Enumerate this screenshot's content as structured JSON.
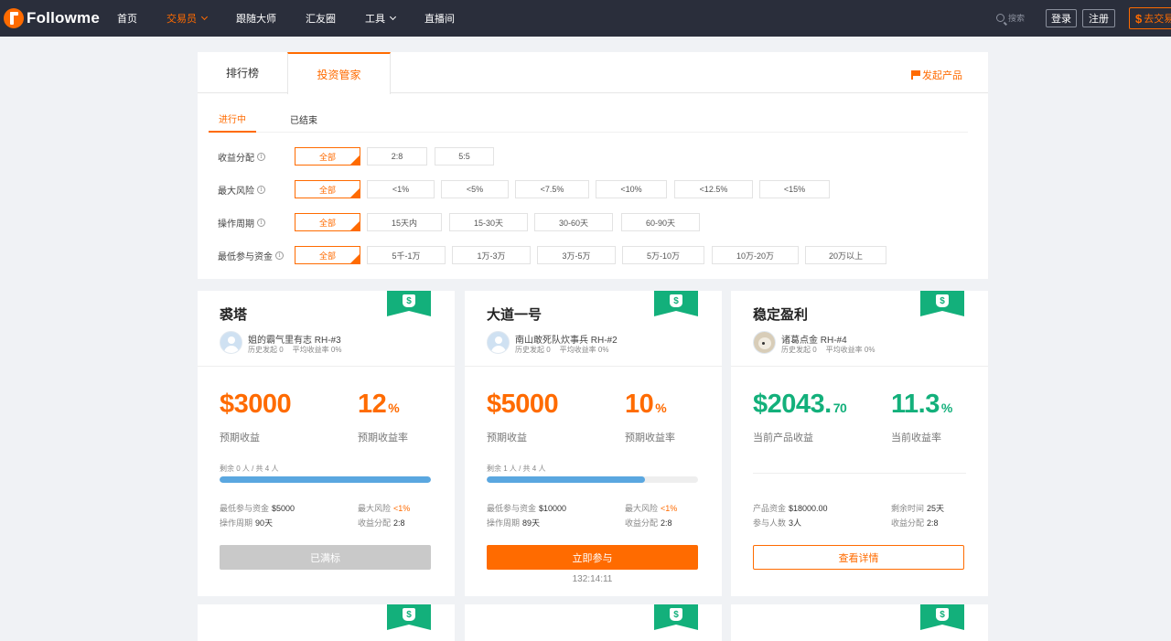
{
  "header": {
    "logo_text": "Followme",
    "nav": [
      {
        "label": "首页",
        "active": false,
        "dropdown": false
      },
      {
        "label": "交易员",
        "active": true,
        "dropdown": true
      },
      {
        "label": "跟随大师",
        "active": false,
        "dropdown": false
      },
      {
        "label": "汇友圈",
        "active": false,
        "dropdown": false
      },
      {
        "label": "工具",
        "active": false,
        "dropdown": true
      },
      {
        "label": "直播间",
        "active": false,
        "dropdown": false
      }
    ],
    "search_label": "搜索",
    "login": "登录",
    "register": "注册",
    "trade_label": "去交易",
    "accent": "#ff6b00",
    "bar_color": "#2a2e3b"
  },
  "panel": {
    "tabs": [
      "排行榜",
      "投资管家"
    ],
    "active_tab": 1,
    "launch": "发起产品",
    "subtabs": [
      "进行中",
      "已结束"
    ],
    "active_subtab": 0,
    "filters": [
      {
        "label": "收益分配",
        "options": [
          "全部",
          "2:8",
          "5:5"
        ]
      },
      {
        "label": "最大风险",
        "options": [
          "全部",
          "<1%",
          "<5%",
          "<7.5%",
          "<10%",
          "<12.5%",
          "<15%"
        ]
      },
      {
        "label": "操作周期",
        "options": [
          "全部",
          "15天内",
          "15-30天",
          "30-60天",
          "60-90天"
        ]
      },
      {
        "label": "最低参与资金",
        "options": [
          "全部",
          "5千-1万",
          "1万-3万",
          "3万-5万",
          "5万-10万",
          "10万-20万",
          "20万以上"
        ]
      }
    ]
  },
  "cards": [
    {
      "title": "裘塔",
      "manager": "姐的霸气里有志 RH-#3",
      "history": "历史发起 0",
      "avg": "平均收益率 0%",
      "amount": "$3000",
      "amount_cents": "",
      "amount_label": "预期收益",
      "rate": "12",
      "rate_unit": "%",
      "rate_label": "预期收益率",
      "remain": "剩余 0 人 / 共 4 人",
      "progress": 1.0,
      "s1_label": "最低参与资金",
      "s1_value": "$5000",
      "s2_label": "最大风险",
      "s2_value": "<1%",
      "s3_label": "操作周期",
      "s3_value": "90天",
      "s4_label": "收益分配",
      "s4_value": "2:8",
      "button": "已满标",
      "timer": ""
    },
    {
      "title": "大道一号",
      "manager": "南山敢死队炊事兵 RH-#2",
      "history": "历史发起 0",
      "avg": "平均收益率 0%",
      "amount": "$5000",
      "amount_cents": "",
      "amount_label": "预期收益",
      "rate": "10",
      "rate_unit": "%",
      "rate_label": "预期收益率",
      "remain": "剩余 1 人 / 共 4 人",
      "progress": 0.75,
      "s1_label": "最低参与资金",
      "s1_value": "$10000",
      "s2_label": "最大风险",
      "s2_value": "<1%",
      "s3_label": "操作周期",
      "s3_value": "89天",
      "s4_label": "收益分配",
      "s4_value": "2:8",
      "button": "立即参与",
      "timer": "132:14:11"
    },
    {
      "title": "稳定盈利",
      "manager": "诸葛点金 RH-#4",
      "history": "历史发起 0",
      "avg": "平均收益率 0%",
      "amount": "$2043.",
      "amount_cents": "70",
      "amount_label": "当前产品收益",
      "rate": "11.3",
      "rate_unit": "%",
      "rate_label": "当前收益率",
      "remain": "",
      "progress": null,
      "s1_label": "产品资金",
      "s1_value": "$18000.00",
      "s2_label": "剩余时间",
      "s2_value": "25天",
      "s3_label": "参与人数",
      "s3_value": "3人",
      "s4_label": "收益分配",
      "s4_value": "2:8",
      "button": "查看详情",
      "timer": ""
    }
  ],
  "colors": {
    "green": "#13b07b",
    "progress": "#5aa7e0"
  }
}
